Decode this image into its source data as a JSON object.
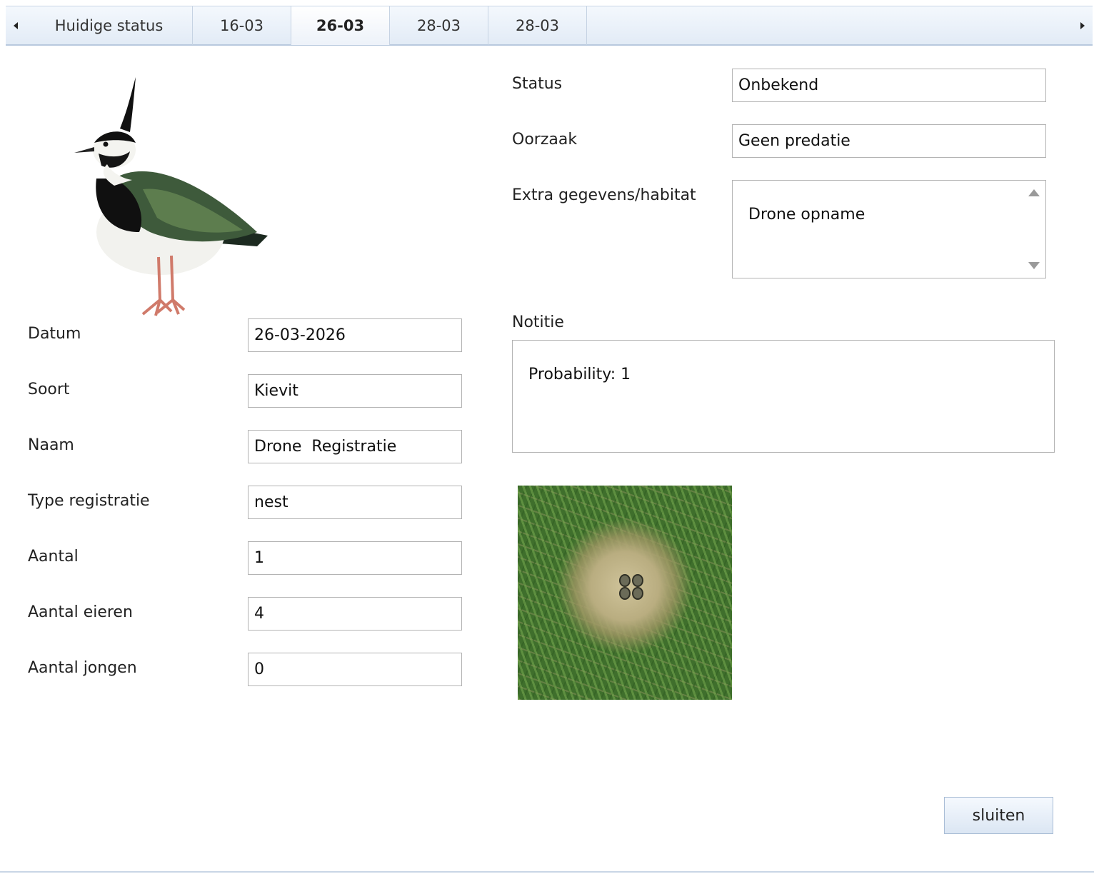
{
  "tabs": [
    {
      "label": "Huidige status"
    },
    {
      "label": "16-03"
    },
    {
      "label": "26-03",
      "active": true
    },
    {
      "label": "28-03"
    },
    {
      "label": "28-03"
    }
  ],
  "icons": {
    "tab_prev": "chevron-left-icon",
    "tab_next": "chevron-right-icon"
  },
  "form": {
    "datum": {
      "label": "Datum",
      "value": "26-03-2026"
    },
    "soort": {
      "label": "Soort",
      "value": "Kievit"
    },
    "naam": {
      "label": "Naam",
      "value": "Drone  Registratie"
    },
    "type_registratie": {
      "label": "Type registratie",
      "value": "nest"
    },
    "aantal": {
      "label": "Aantal",
      "value": "1"
    },
    "aantal_eieren": {
      "label": "Aantal eieren",
      "value": "4"
    },
    "aantal_jongen": {
      "label": "Aantal jongen",
      "value": "0"
    }
  },
  "details": {
    "status": {
      "label": "Status",
      "value": "Onbekend"
    },
    "oorzaak": {
      "label": "Oorzaak",
      "value": "Geen predatie"
    },
    "extra": {
      "label": "Extra gegevens/habitat",
      "value": "Drone opname"
    },
    "notitie": {
      "label": "Notitie",
      "value": "Probability: 1"
    }
  },
  "buttons": {
    "close": "sluiten"
  },
  "colors": {
    "tab_bg": "#e2ebf6",
    "border": "#b3b3b3",
    "button_bg": "#dbe6f3"
  }
}
